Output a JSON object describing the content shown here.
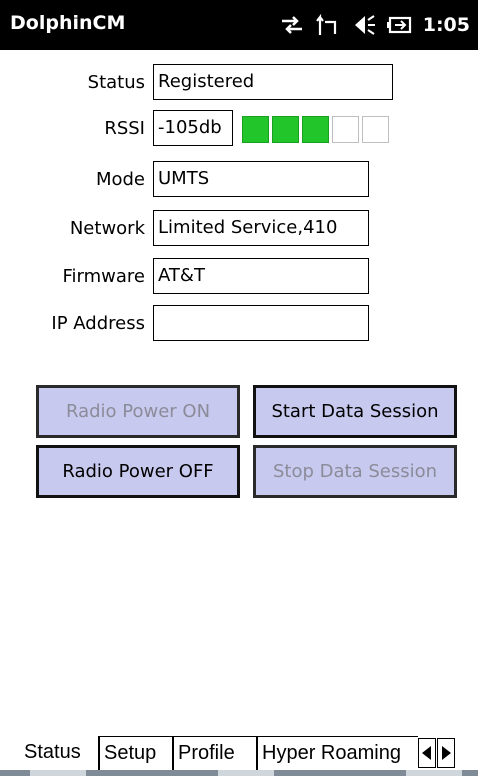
{
  "app": {
    "title": "DolphinCM",
    "time": "1:05"
  },
  "status_icons": [
    "data-sync-icon",
    "signal-icon",
    "speaker-icon",
    "battery-charging-icon"
  ],
  "fields": {
    "status": {
      "label": "Status",
      "value": "Registered"
    },
    "rssi": {
      "label": "RSSI",
      "value": "-105db",
      "bars_on": 3,
      "bars_total": 5,
      "bar_color": "#22c52a"
    },
    "mode": {
      "label": "Mode",
      "value": "UMTS"
    },
    "network": {
      "label": "Network",
      "value": "Limited Service,410"
    },
    "firmware": {
      "label": "Firmware",
      "value": "AT&T"
    },
    "ip": {
      "label": "IP Address",
      "value": ""
    }
  },
  "buttons": {
    "radio_on": {
      "label": "Radio Power ON",
      "enabled": false
    },
    "start_data": {
      "label": "Start Data Session",
      "enabled": true
    },
    "radio_off": {
      "label": "Radio Power OFF",
      "enabled": true
    },
    "stop_data": {
      "label": "Stop Data Session",
      "enabled": false
    }
  },
  "tabs": [
    {
      "label": "Status",
      "active": true
    },
    {
      "label": "Setup",
      "active": false
    },
    {
      "label": "Profile",
      "active": false
    },
    {
      "label": "Hyper Roaming",
      "active": false
    }
  ],
  "softkeys": [
    "windows-start-icon",
    "keyboard-icon",
    "close-icon"
  ],
  "colors": {
    "button_bg": "#c8c9ee",
    "title_bg": "#000000"
  }
}
